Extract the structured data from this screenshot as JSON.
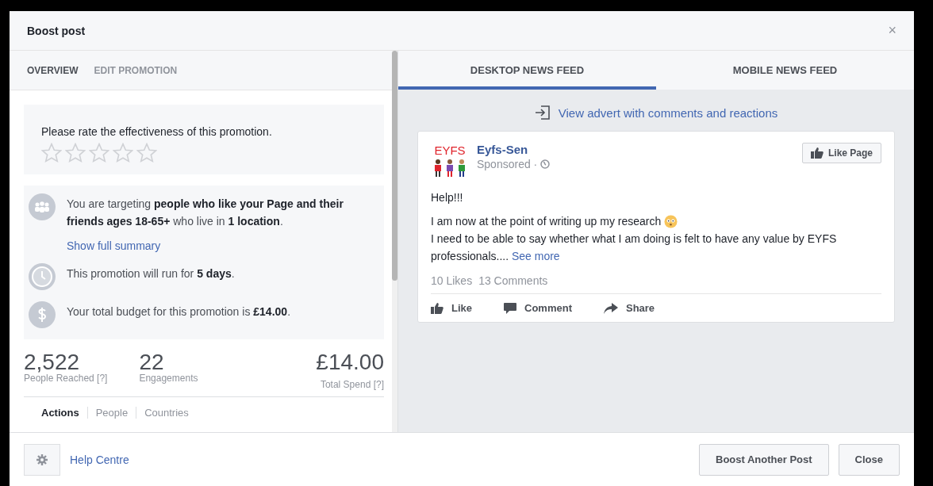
{
  "dialog": {
    "title": "Boost post",
    "close": "×"
  },
  "left_tabs": [
    {
      "label": "OVERVIEW",
      "selected": true
    },
    {
      "label": "EDIT PROMOTION",
      "selected": false
    }
  ],
  "rating": {
    "prompt": "Please rate the effectiveness of this promotion.",
    "stars": 0
  },
  "summary": [
    {
      "kind": "audience",
      "text": "You are targeting **people who like your Page and their friends ages 18-65+** who live in **1 location**.",
      "link": "Show full summary"
    },
    {
      "kind": "duration",
      "text": "This promotion will run for **5 days**."
    },
    {
      "kind": "budget",
      "text": "Your total budget for this promotion is **£14.00**."
    }
  ],
  "stats": [
    {
      "value": "2,522",
      "label": "People Reached [?]"
    },
    {
      "value": "22",
      "label": "Engagements"
    },
    {
      "value": "£14.00",
      "label": "Total Spend [?]"
    }
  ],
  "stat_tabs": [
    {
      "label": "Actions",
      "selected": true
    },
    {
      "label": "People",
      "selected": false
    },
    {
      "label": "Countries",
      "selected": false
    }
  ],
  "preview_tabs": [
    {
      "label": "DESKTOP NEWS FEED",
      "selected": true
    },
    {
      "label": "MOBILE NEWS FEED",
      "selected": false
    }
  ],
  "view_link": "View advert with comments and reactions",
  "post": {
    "logo_text": "EYFS",
    "page": "Eyfs-Sen",
    "meta": "Sponsored ·",
    "like_page": "Like Page",
    "heading": "Help!!!",
    "line1": "I am now at the point of writing up my research",
    "line2": "I need to be able to say whether what I am doing is felt to have any value by EYFS professionals....",
    "see_more": "See more",
    "counts": [
      "10 Likes",
      "13 Comments"
    ],
    "actions": [
      {
        "kind": "like",
        "label": "Like"
      },
      {
        "kind": "comment",
        "label": "Comment"
      },
      {
        "kind": "share",
        "label": "Share"
      }
    ]
  },
  "footer": {
    "help": "Help Centre",
    "buttons": [
      "Boost Another Post",
      "Close"
    ]
  }
}
